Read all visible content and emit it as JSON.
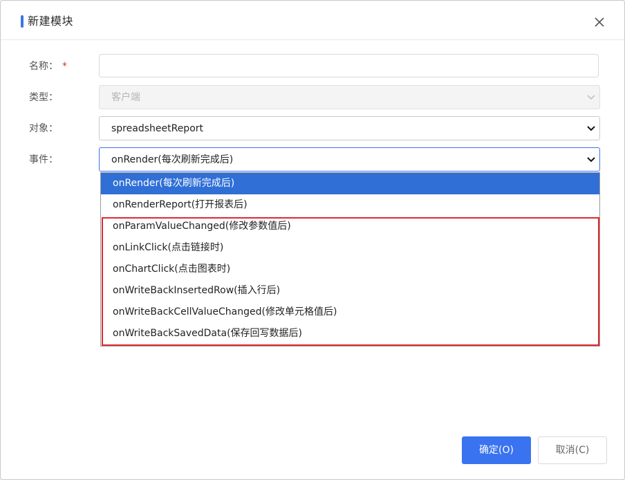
{
  "dialog": {
    "title": "新建模块",
    "accent_color": "#3a73f0",
    "close_icon": "close-icon"
  },
  "form": {
    "name_label": "名称：",
    "name_required_mark": "*",
    "name_value": "",
    "type_label": "类型：",
    "type_value": "客户端",
    "object_label": "对象：",
    "object_value": "spreadsheetReport",
    "event_label": "事件：",
    "event_value": "onRender(每次刷新完成后)"
  },
  "event_options": [
    "onRender(每次刷新完成后)",
    "onRenderReport(打开报表后)",
    "onParamValueChanged(修改参数值后)",
    "onLinkClick(点击链接时)",
    "onChartClick(点击图表时)",
    "onWriteBackInsertedRow(插入行后)",
    "onWriteBackCellValueChanged(修改单元格值后)",
    "onWriteBackSavedData(保存回写数据后)"
  ],
  "selected_option_index": 0,
  "highlight_color": "#e0282e",
  "buttons": {
    "ok": "确定(O)",
    "cancel": "取消(C)"
  }
}
